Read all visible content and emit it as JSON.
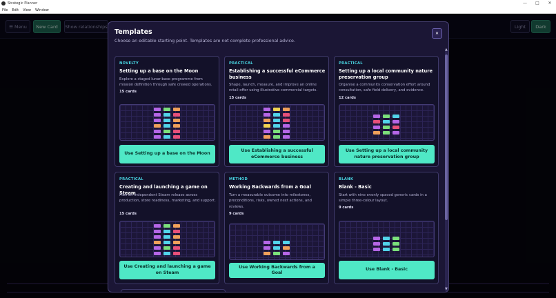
{
  "window": {
    "title": "Strategic Planner",
    "controls": [
      "—",
      "□",
      "✕"
    ]
  },
  "menu": [
    "File",
    "Edit",
    "View",
    "Window"
  ],
  "toolbar": {
    "menu_label": "☰ Menu",
    "new_card_label": "New Card",
    "show_relationships_label": "Show relationships",
    "light_label": "Light",
    "dark_label": "Dark"
  },
  "modal": {
    "title": "Templates",
    "subtitle": "Choose an editable starting point. Templates are not complete professional advice.",
    "close_label": "✕"
  },
  "templates": [
    {
      "category": "NOVELTY",
      "title": "Setting up a base on the Moon",
      "description": "Explore a staged lunar-base programme from mission definition through safe crewed operations.",
      "count": "15 cards",
      "button": "Use Setting up a base on the Moon"
    },
    {
      "category": "PRACTICAL",
      "title": "Establishing a successful eCommerce business",
      "description": "Shape, launch, measure, and improve an online retail offer using illustrative commercial targets.",
      "count": "15 cards",
      "button": "Use Establishing a successful eCommerce business"
    },
    {
      "category": "PRACTICAL",
      "title": "Setting up a local community nature preservation group",
      "description": "Organise a community conservation effort around consultation, safe field delivery, and evidence.",
      "count": "12 cards",
      "button": "Use Setting up a local community nature preservation group"
    },
    {
      "category": "PRACTICAL",
      "title": "Creating and launching a game on Steam",
      "description": "Plan an independent Steam release across production, store readiness, marketing, and support.",
      "count": "15 cards",
      "button": "Use Creating and launching a game on Steam"
    },
    {
      "category": "METHOD",
      "title": "Working Backwards from a Goal",
      "description": "Turn a measurable outcome into milestones, preconditions, risks, owned next actions, and reviews.",
      "count": "9 cards",
      "button": "Use Working Backwards from a Goal"
    },
    {
      "category": "BLANK",
      "title": "Blank - Basic",
      "description": "Start with nine evenly spaced generic cards in a simple three-colour layout.",
      "count": "9 cards",
      "button": "Use Blank - Basic"
    }
  ],
  "scroll": {
    "up_icon": "▲",
    "down_icon": "▼"
  },
  "colors": {
    "accent": "#4fe8c6",
    "category": "#49d6e3",
    "mini_purple": "#b566e6",
    "mini_yellow": "#f2d451",
    "mini_orange": "#f0a05a",
    "mini_pink": "#e8507a",
    "mini_cyan": "#52d4ea",
    "mini_green": "#7be07b"
  }
}
